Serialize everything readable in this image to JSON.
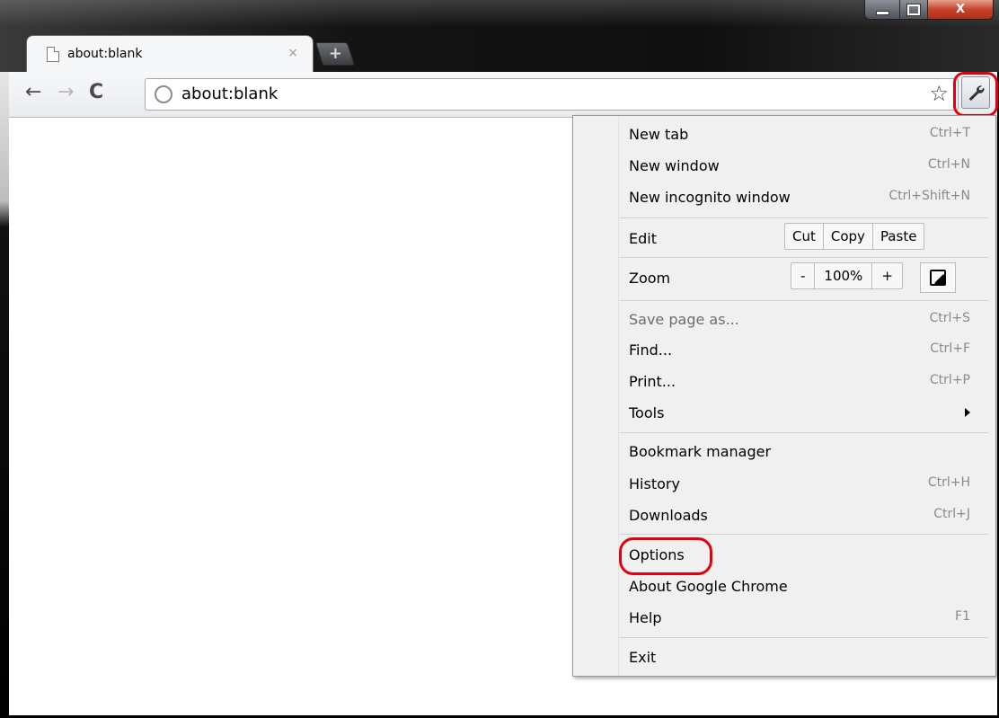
{
  "window": {
    "tab_title": "about:blank",
    "tab_close": "×",
    "new_tab": "+"
  },
  "toolbar": {
    "url": "about:blank"
  },
  "menu": {
    "items": [
      {
        "label": "New tab",
        "shortcut": "Ctrl+T"
      },
      {
        "label": "New window",
        "shortcut": "Ctrl+N"
      },
      {
        "label": "New incognito window",
        "shortcut": "Ctrl+Shift+N"
      }
    ],
    "edit": {
      "label": "Edit",
      "cut": "Cut",
      "copy": "Copy",
      "paste": "Paste"
    },
    "zoom": {
      "label": "Zoom",
      "minus": "-",
      "value": "100%",
      "plus": "+"
    },
    "items2": [
      {
        "label": "Save page as...",
        "shortcut": "Ctrl+S"
      },
      {
        "label": "Find...",
        "shortcut": "Ctrl+F"
      },
      {
        "label": "Print...",
        "shortcut": "Ctrl+P"
      },
      {
        "label": "Tools",
        "shortcut": ""
      }
    ],
    "items3": [
      {
        "label": "Bookmark manager",
        "shortcut": ""
      },
      {
        "label": "History",
        "shortcut": "Ctrl+H"
      },
      {
        "label": "Downloads",
        "shortcut": "Ctrl+J"
      }
    ],
    "items4": [
      {
        "label": "Options",
        "shortcut": ""
      },
      {
        "label": "About Google Chrome",
        "shortcut": ""
      },
      {
        "label": "Help",
        "shortcut": "F1"
      }
    ],
    "exit": {
      "label": "Exit"
    }
  }
}
